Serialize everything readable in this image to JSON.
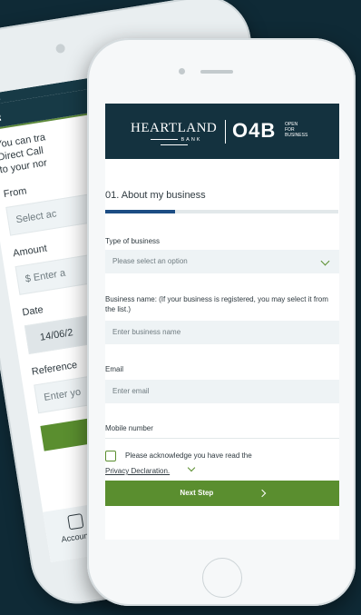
{
  "back_phone": {
    "intro": [
      "You can tra",
      "Direct Call",
      "to your nor"
    ],
    "from_label": "From",
    "from_placeholder": "Select ac",
    "amount_label": "Amount",
    "amount_placeholder": "$ Enter a",
    "date_label": "Date",
    "date_value": "14/06/2",
    "reference_label": "Reference",
    "reference_placeholder": "Enter yo",
    "tab_accounts": "Accounts"
  },
  "front_phone": {
    "brand": {
      "heartland": "HEARTLAND",
      "bank": "BANK",
      "o4b": "O4B",
      "tagline": [
        "OPEN",
        "FOR",
        "BUSINESS"
      ]
    },
    "section_title": "01. About my business",
    "progress_percent": 30,
    "type_label": "Type of business",
    "type_placeholder": "Please select an option",
    "name_label": "Business name: (If your business is registered, you may select it from the list.)",
    "name_placeholder": "Enter business name",
    "email_label": "Email",
    "email_placeholder": "Enter email",
    "mobile_label": "Mobile number",
    "ack_text": "Please acknowledge you have read the",
    "privacy_link": "Privacy Declaration.",
    "next_button": "Next Step"
  },
  "colors": {
    "background": "#0f2a36",
    "brand_navy": "#14323f",
    "accent_green": "#5a8e2f",
    "progress_blue": "#1c4d84"
  }
}
